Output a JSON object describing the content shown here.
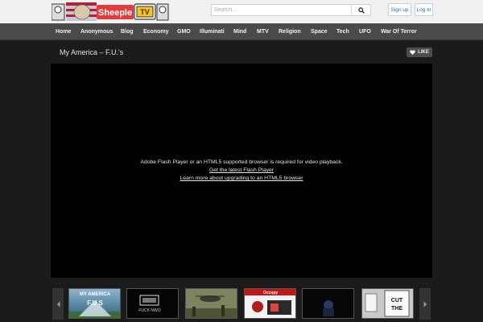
{
  "header": {
    "logo_text": "Sheeple",
    "logo_badge": "TV",
    "search": {
      "placeholder": "Search..."
    },
    "signup_label": "Sign up",
    "login_label": "Log In"
  },
  "nav": {
    "items": [
      {
        "label": "Home"
      },
      {
        "label": "Anonymous"
      },
      {
        "label": "Blog"
      },
      {
        "label": "Economy"
      },
      {
        "label": "GMO"
      },
      {
        "label": "Illuminati"
      },
      {
        "label": "Mind"
      },
      {
        "label": "MTV"
      },
      {
        "label": "Religion"
      },
      {
        "label": "Space"
      },
      {
        "label": "Tech"
      },
      {
        "label": "UFO"
      },
      {
        "label": "War Of Terror"
      }
    ]
  },
  "video": {
    "title": "My America – F.U.'s",
    "like_label": "LIKE",
    "message_line1": "Adobe Flash Player or an HTML5 supported browser is required for video playback.",
    "message_link1": "Get the latest Flash Player",
    "message_link2": "Learn more about upgrading to an HTML5 browser"
  },
  "carousel": {
    "thumbs": [
      {
        "title_line1": "MY AMERICA",
        "title_line2": "F.U.S"
      },
      {
        "caption": "FUCK NWO"
      },
      {},
      {
        "caption": "Occupy"
      },
      {},
      {
        "sign_line1": "CUT",
        "sign_line2": "THE"
      }
    ]
  },
  "colors": {
    "accent_link": "#2a6fb0",
    "nav_bg": "#4a4a4a",
    "page_bg": "#1b1b1b"
  }
}
